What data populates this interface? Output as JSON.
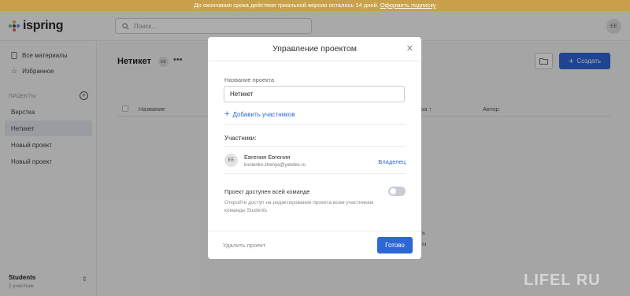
{
  "banner": {
    "text": "До окончания срока действия триальной версии осталось 14 дней.",
    "link": "Оформить подписку"
  },
  "topbar": {
    "logo_text": "ispring",
    "search_placeholder": "Поиск...",
    "avatar": "EE"
  },
  "sidebar": {
    "all_materials": "Все материалы",
    "favorites": "Избранное",
    "projects_heading": "ПРОЕКТЫ",
    "projects": [
      {
        "label": "Верстка"
      },
      {
        "label": "Нетикет"
      },
      {
        "label": "Новый проект"
      },
      {
        "label": "Новый проект"
      }
    ],
    "team_name": "Students",
    "team_members": "1 участник"
  },
  "main": {
    "title": "Нетикет",
    "badge": "EE",
    "create_label": "Создать",
    "columns": {
      "name": "Название",
      "date_fragment": "ра ↑",
      "author": "Автор"
    },
    "empty_fragments": [
      "ь",
      "ы"
    ]
  },
  "modal": {
    "title": "Управление проектом",
    "project_name_label": "Название проекта",
    "project_name_value": "Нетикет",
    "add_members": "Добавить участников",
    "members_label": "Участники:",
    "member": {
      "avatar": "EE",
      "name": "Евгения Евгения",
      "email": "kostenko-zhenya@yandex.ru",
      "role": "Владелец"
    },
    "team_access_title": "Проект доступен всей команде",
    "team_access_desc": "Откройте доступ на редактирование проекта всем участникам команды Students",
    "team_access_enabled": false,
    "delete_label": "Удалить проект",
    "done_label": "Готово"
  },
  "watermark": "LIFEL RU",
  "colors": {
    "accent": "#2e66d6",
    "banner": "#c8a14a"
  }
}
